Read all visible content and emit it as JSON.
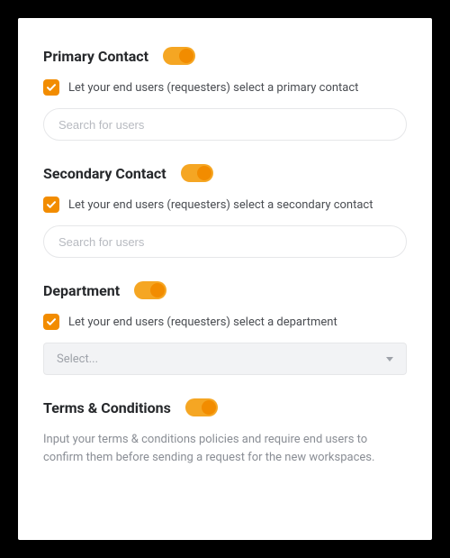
{
  "colors": {
    "accent": "#f28c00",
    "accentLight": "#f5a623"
  },
  "sections": {
    "primary": {
      "title": "Primary Contact",
      "toggle": true,
      "checkbox": true,
      "checkLabel": "Let your end users (requesters) select a primary contact",
      "searchPlaceholder": "Search for users"
    },
    "secondary": {
      "title": "Secondary Contact",
      "toggle": true,
      "checkbox": true,
      "checkLabel": "Let your end users (requesters) select a secondary contact",
      "searchPlaceholder": "Search for users"
    },
    "department": {
      "title": "Department",
      "toggle": true,
      "checkbox": true,
      "checkLabel": "Let your end users (requesters) select a department",
      "selectPlaceholder": "Select..."
    },
    "terms": {
      "title": "Terms & Conditions",
      "toggle": true,
      "description": "Input your terms & conditions policies and require end users to confirm them before sending a request for the new workspaces."
    }
  }
}
